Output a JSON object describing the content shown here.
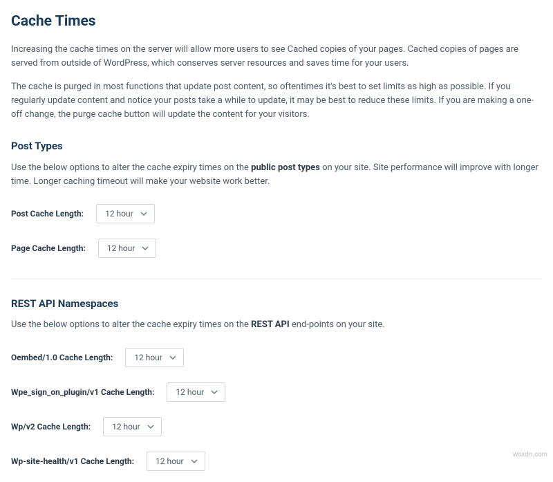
{
  "page": {
    "title": "Cache Times",
    "intro_p1": "Increasing the cache times on the server will allow more users to see Cached copies of your pages. Cached copies of pages are served from outside of WordPress, which conserves server resources and saves time for your users.",
    "intro_p2": "The cache is purged in most functions that update post content, so oftentimes it's best to set limits as high as possible. If you regularly update content and notice your posts take a while to update, it may be best to reduce these limits. If you are making a one-off change, the purge cache button will update the content for your visitors."
  },
  "post_types": {
    "heading": "Post Types",
    "description_pre": "Use the below options to alter the cache expiry times on the ",
    "description_bold": "public post types",
    "description_post": " on your site. Site performance will improve with longer time. Longer caching timeout will make your website work better.",
    "fields": {
      "post_cache": {
        "label": "Post Cache Length:",
        "value": "12 hour"
      },
      "page_cache": {
        "label": "Page Cache Length:",
        "value": "12 hour"
      }
    }
  },
  "rest_api": {
    "heading": "REST API Namespaces",
    "description_pre": "Use the below options to alter the cache expiry times on the ",
    "description_bold": "REST API",
    "description_post": " end-points on your site.",
    "fields": {
      "oembed": {
        "label": "Oembed/1.0 Cache Length:",
        "value": "12 hour"
      },
      "wpe_signon": {
        "label": "Wpe_sign_on_plugin/v1 Cache Length:",
        "value": "12 hour"
      },
      "wp_v2": {
        "label": "Wp/v2 Cache Length:",
        "value": "12 hour"
      },
      "site_health": {
        "label": "Wp-site-health/v1 Cache Length:",
        "value": "12 hour"
      }
    }
  },
  "watermark": "wsxdn.com"
}
